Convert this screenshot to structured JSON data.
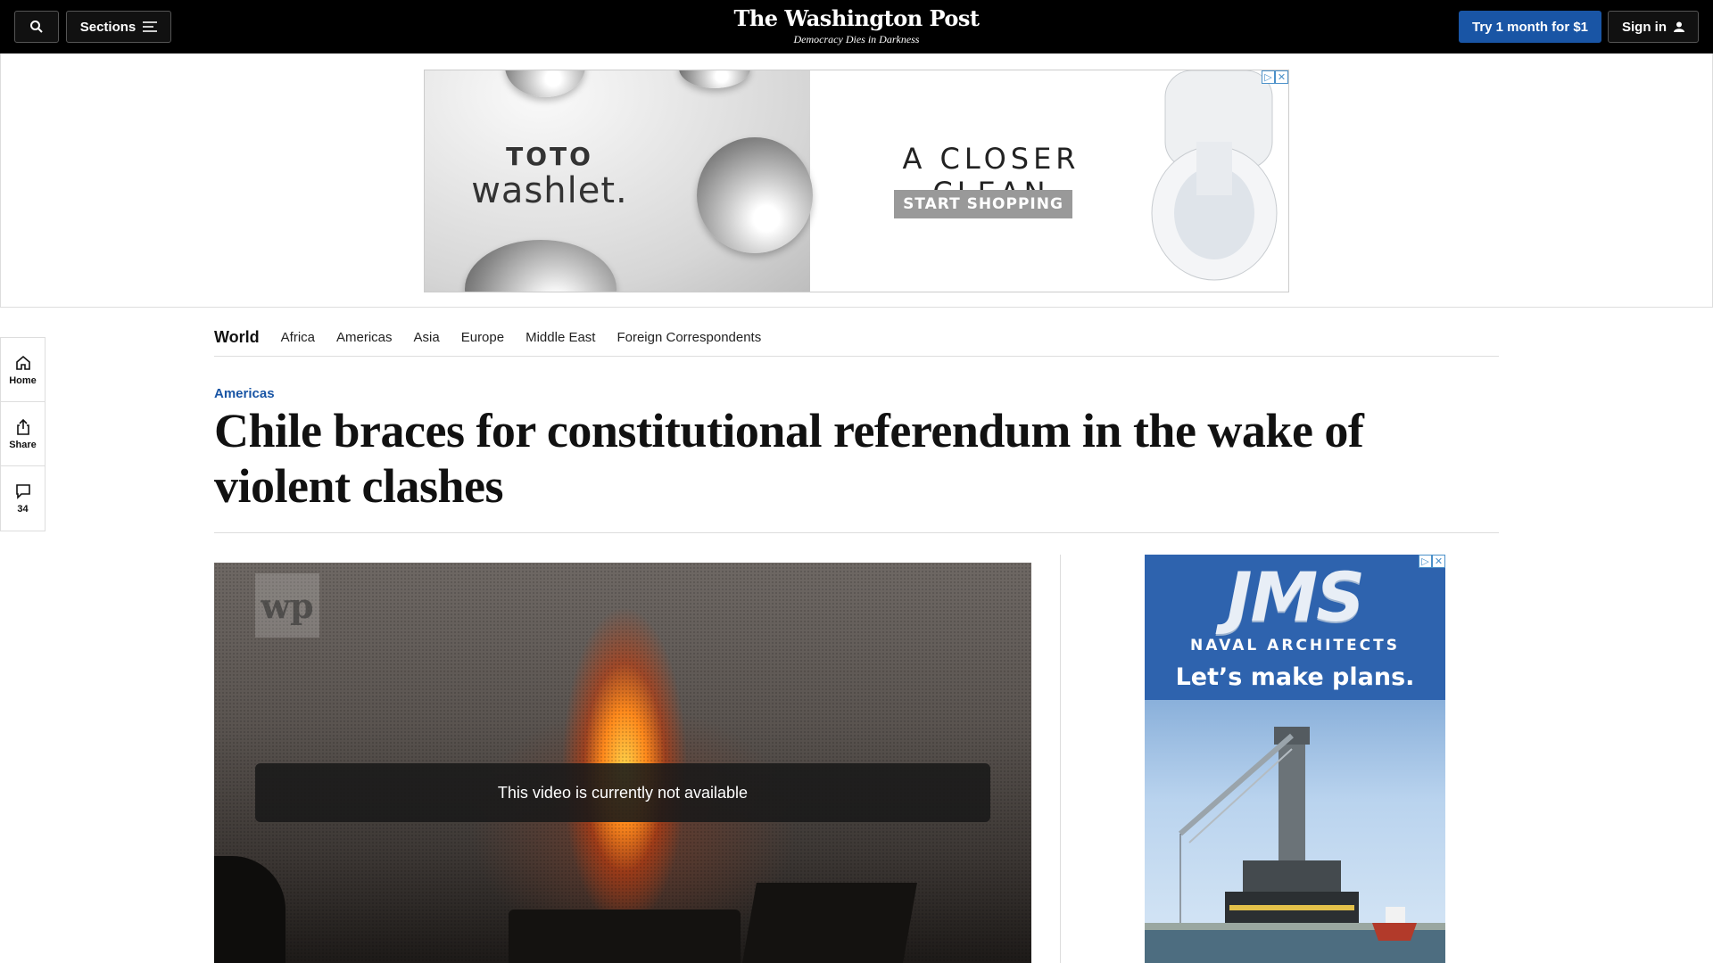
{
  "header": {
    "sections_label": "Sections",
    "logo": "The Washington Post",
    "tagline": "Democracy Dies in Darkness",
    "subscribe_label": "Try 1 month for $1",
    "signin_label": "Sign in"
  },
  "top_ad": {
    "brand_line1": "TOTO",
    "brand_line2": "washlet.",
    "headline": "A CLOSER CLEAN",
    "cta": "START SHOPPING",
    "adchoices": [
      "▷",
      "✕"
    ]
  },
  "rail": {
    "home": "Home",
    "share": "Share",
    "comments_count": "34"
  },
  "subnav": {
    "title": "World",
    "links": [
      "Africa",
      "Americas",
      "Asia",
      "Europe",
      "Middle East",
      "Foreign Correspondents"
    ]
  },
  "article": {
    "kicker": "Americas",
    "headline": "Chile braces for constitutional referendum in the wake of violent clashes"
  },
  "video": {
    "watermark": "wp",
    "message": "This video is currently not available"
  },
  "side_ad": {
    "logo": "JMS",
    "subtitle": "NAVAL ARCHITECTS",
    "tagline": "Let’s make plans.",
    "adchoices": [
      "▷",
      "✕"
    ]
  },
  "colors": {
    "accent": "#1955a5",
    "topbar": "#000000"
  }
}
